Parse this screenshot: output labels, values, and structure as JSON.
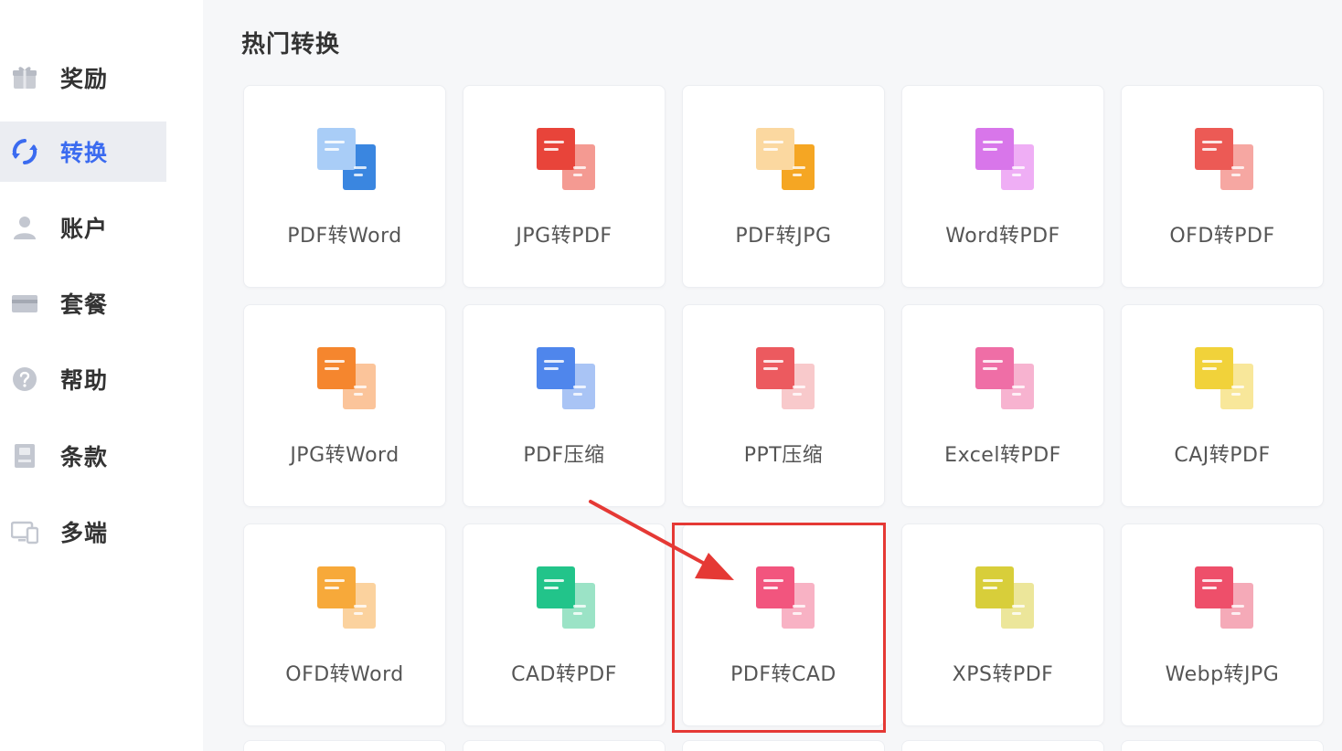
{
  "sidebar": {
    "items": [
      {
        "label": "奖励",
        "icon": "gift-icon",
        "active": false
      },
      {
        "label": "转换",
        "icon": "convert-icon",
        "active": true
      },
      {
        "label": "账户",
        "icon": "user-icon",
        "active": false
      },
      {
        "label": "套餐",
        "icon": "card-icon",
        "active": false
      },
      {
        "label": "帮助",
        "icon": "help-icon",
        "active": false
      },
      {
        "label": "条款",
        "icon": "document-icon",
        "active": false
      },
      {
        "label": "多端",
        "icon": "devices-icon",
        "active": false
      }
    ]
  },
  "main": {
    "section_title": "热门转换",
    "tools": [
      {
        "label": "PDF转Word",
        "icon": "pdf-to-word-icon",
        "colors": [
          "#a9cdf7",
          "#3a86e0"
        ]
      },
      {
        "label": "JPG转PDF",
        "icon": "jpg-to-pdf-icon",
        "colors": [
          "#e8443a",
          "#f49a92"
        ]
      },
      {
        "label": "PDF转JPG",
        "icon": "pdf-to-jpg-icon",
        "colors": [
          "#fbd8a0",
          "#f5a623"
        ]
      },
      {
        "label": "Word转PDF",
        "icon": "word-to-pdf-icon",
        "colors": [
          "#d876ea",
          "#efaef5"
        ]
      },
      {
        "label": "OFD转PDF",
        "icon": "ofd-to-pdf-icon",
        "colors": [
          "#ec5a55",
          "#f6a7a2"
        ]
      },
      {
        "label": "JPG转Word",
        "icon": "jpg-to-word-icon",
        "colors": [
          "#f5862e",
          "#fbc49a"
        ]
      },
      {
        "label": "PDF压缩",
        "icon": "pdf-compress-icon",
        "colors": [
          "#4f86ec",
          "#a9c4f5"
        ]
      },
      {
        "label": "PPT压缩",
        "icon": "ppt-compress-icon",
        "colors": [
          "#ec5a5f",
          "#f8c9cb"
        ]
      },
      {
        "label": "Excel转PDF",
        "icon": "excel-to-pdf-icon",
        "colors": [
          "#ef6ea6",
          "#f7b3d0"
        ]
      },
      {
        "label": "CAJ转PDF",
        "icon": "caj-to-pdf-icon",
        "colors": [
          "#f1d23a",
          "#f8e79a"
        ]
      },
      {
        "label": "OFD转Word",
        "icon": "ofd-to-word-icon",
        "colors": [
          "#f7a93a",
          "#fbd29e"
        ]
      },
      {
        "label": "CAD转PDF",
        "icon": "cad-to-pdf-icon",
        "colors": [
          "#22c48a",
          "#9be3c6"
        ]
      },
      {
        "label": "PDF转CAD",
        "icon": "pdf-to-cad-icon",
        "colors": [
          "#f2557e",
          "#f8b2c4"
        ]
      },
      {
        "label": "XPS转PDF",
        "icon": "xps-to-pdf-icon",
        "colors": [
          "#d8ce3a",
          "#ece69a"
        ]
      },
      {
        "label": "Webp转JPG",
        "icon": "webp-to-jpg-icon",
        "colors": [
          "#ee4f6a",
          "#f5aab8"
        ]
      }
    ],
    "highlighted_tool": "PDF转CAD",
    "annotation_color": "#e53935"
  },
  "colors": {
    "accent": "#3b6bf0",
    "sidebar_active_bg": "#ebedf2",
    "main_bg": "#f6f7f9"
  }
}
